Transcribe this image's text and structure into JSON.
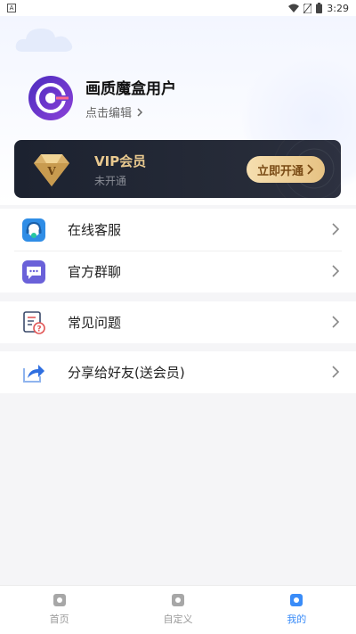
{
  "status_bar": {
    "indicator": "A",
    "time": "3:29"
  },
  "profile": {
    "username": "画质魔盒用户",
    "edit_label": "点击编辑"
  },
  "vip": {
    "title": "VIP会员",
    "status": "未开通",
    "button_label": "立即开通"
  },
  "menu_groups": [
    [
      {
        "label": "在线客服",
        "icon": "customer-service-icon"
      },
      {
        "label": "官方群聊",
        "icon": "chat-bubble-icon"
      }
    ],
    [
      {
        "label": "常见问题",
        "icon": "faq-document-icon"
      }
    ],
    [
      {
        "label": "分享给好友(送会员)",
        "icon": "share-icon"
      }
    ]
  ],
  "tabs": [
    {
      "label": "首页",
      "icon": "home-icon"
    },
    {
      "label": "自定义",
      "icon": "custom-icon"
    },
    {
      "label": "我的",
      "icon": "profile-icon",
      "active": true
    }
  ],
  "colors": {
    "accent": "#3a8cf8",
    "vip_gold": "#e9c98f",
    "vip_dark": "#1c2230"
  }
}
